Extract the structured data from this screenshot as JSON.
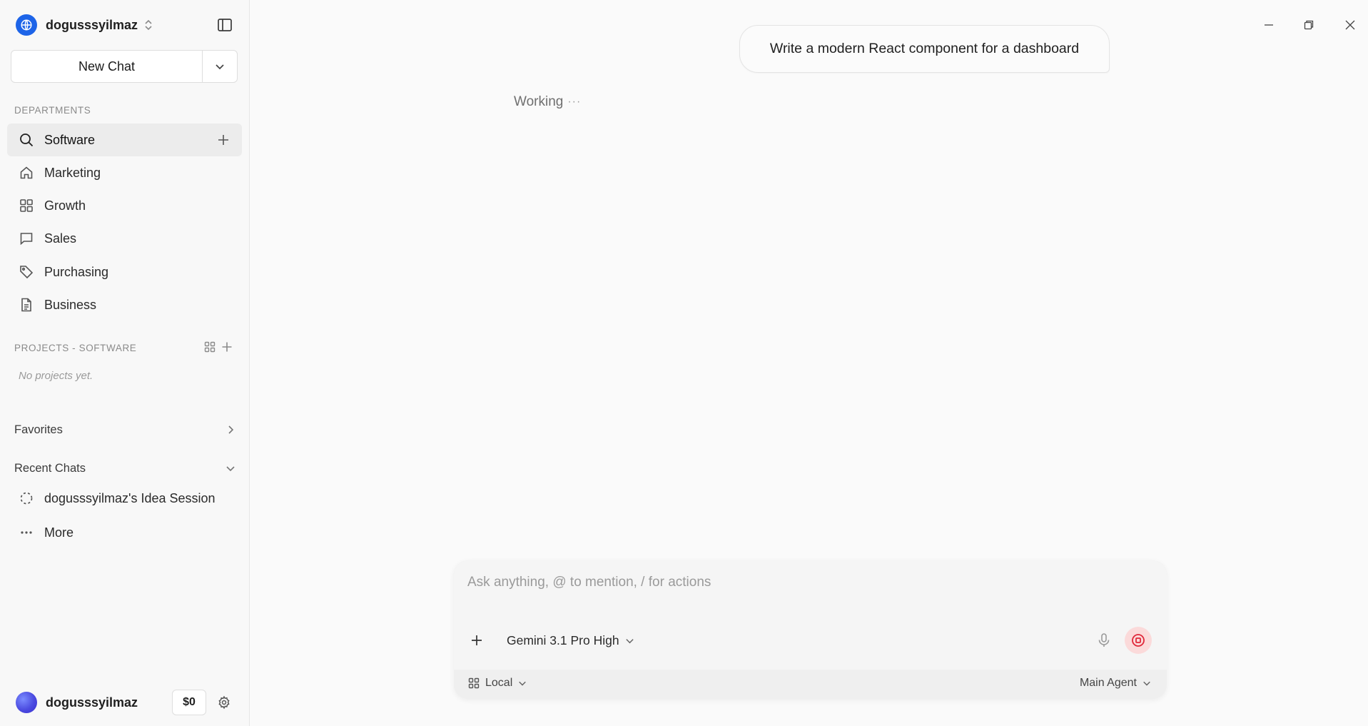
{
  "workspace": {
    "name": "dogusssyilmaz"
  },
  "new_chat": {
    "label": "New Chat"
  },
  "departments": {
    "label": "DEPARTMENTS",
    "items": [
      {
        "label": "Software",
        "icon": "search-icon",
        "active": true
      },
      {
        "label": "Marketing",
        "icon": "home-icon"
      },
      {
        "label": "Growth",
        "icon": "grid-icon"
      },
      {
        "label": "Sales",
        "icon": "message-icon"
      },
      {
        "label": "Purchasing",
        "icon": "tag-icon"
      },
      {
        "label": "Business",
        "icon": "document-icon"
      }
    ]
  },
  "projects": {
    "label": "PROJECTS - SOFTWARE",
    "empty_text": "No projects yet."
  },
  "favorites": {
    "label": "Favorites"
  },
  "recent_chats": {
    "label": "Recent Chats",
    "items": [
      {
        "label": "dogusssyilmaz's Idea Session",
        "icon": "loading-icon"
      }
    ],
    "more_label": "More"
  },
  "user": {
    "name": "dogusssyilmaz",
    "credit": "$0"
  },
  "chat": {
    "user_message": "Write a modern React component for a dashboard",
    "status": "Working",
    "status_dots": "···"
  },
  "composer": {
    "placeholder": "Ask anything, @ to mention, / for actions",
    "model": "Gemini 3.1 Pro High",
    "environment": "Local",
    "agent": "Main Agent"
  },
  "colors": {
    "accent_blue": "#1d64e8",
    "stop_bg": "#fbdada",
    "stop_fg": "#e0283a"
  }
}
